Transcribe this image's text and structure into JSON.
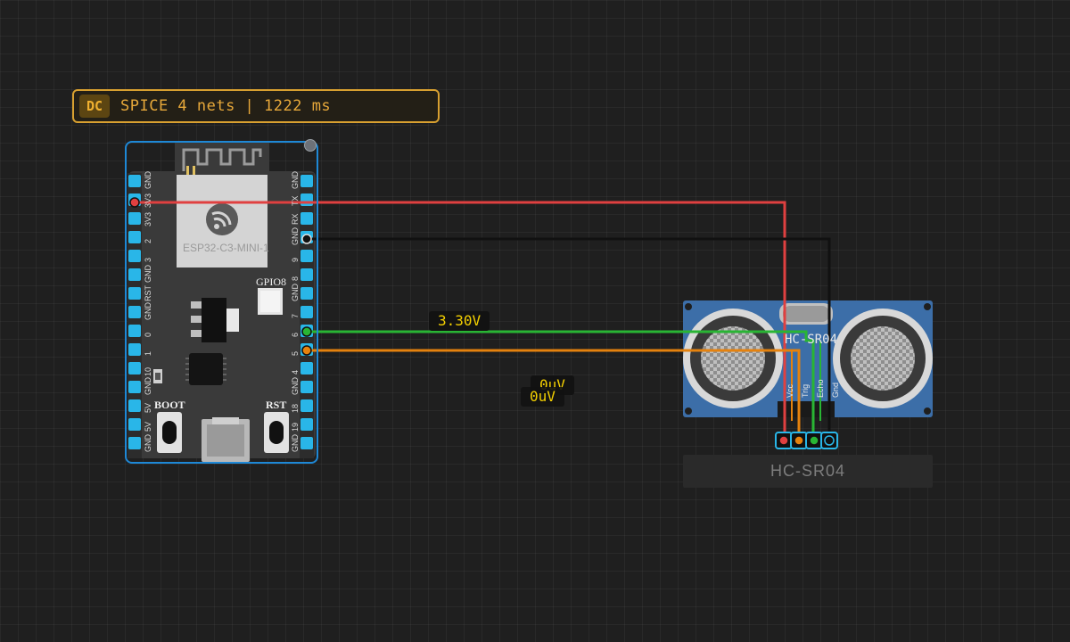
{
  "sim": {
    "mode": "DC",
    "status": "SPICE 4 nets | 1222 ms"
  },
  "board": {
    "module_label": "ESP32-C3-MINI-1",
    "gpio_led_label": "GPIO8",
    "boot_label": "BOOT",
    "rst_label": "RST",
    "left_pins": [
      "GND",
      "3V3",
      "3V3",
      "2",
      "3",
      "GND",
      "RST",
      "GND",
      "0",
      "1",
      "10",
      "GND",
      "5V",
      "5V",
      "GND"
    ],
    "right_pins": [
      "GND",
      "TX",
      "RX",
      "GND",
      "9",
      "8",
      "GND",
      "7",
      "6",
      "5",
      "4",
      "GND",
      "18",
      "19",
      "GND"
    ]
  },
  "sensor": {
    "name": "HC-SR04",
    "silk_label": "HC-SR04",
    "pins": [
      "Vcc",
      "Trig",
      "Echo",
      "Gnd"
    ]
  },
  "probes": {
    "vcc": "3.30V",
    "trig": "0uV",
    "echo": "0uV"
  },
  "colors": {
    "wire_power": "#e04040",
    "wire_ground": "#111111",
    "wire_signal_trig": "#29b534",
    "wire_signal_echo": "#e5820e",
    "pin": "#29b6e8",
    "selection": "#1e88d6",
    "accent": "#e7a83a"
  }
}
